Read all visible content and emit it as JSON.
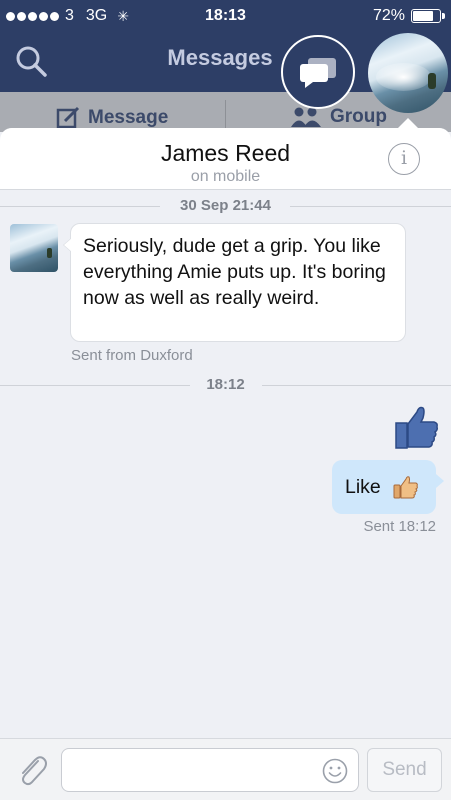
{
  "status_bar": {
    "carrier": "3",
    "network": "3G",
    "time": "18:13",
    "battery": "72%",
    "battery_level": 0.72
  },
  "nav": {
    "title": "Messages"
  },
  "subnav": {
    "message_label": "Message",
    "group_label": "Group"
  },
  "conversation": {
    "contact_name": "James Reed",
    "contact_status": "on mobile",
    "messages": [
      {
        "date_separator": "30 Sep 21:44",
        "direction": "incoming",
        "text": "Seriously, dude get a grip. You like everything Amie puts up. It's boring now as well as really weird.",
        "meta": "Sent from Duxford"
      },
      {
        "date_separator": "18:12",
        "direction": "outgoing",
        "sticker": "like-icon",
        "text": "Like",
        "meta": "Sent 18:12"
      }
    ]
  },
  "composer": {
    "placeholder": "",
    "send_label": "Send"
  },
  "colors": {
    "nav_bg": "#2d3e66",
    "outgoing_bubble": "#cfe7fb",
    "like_blue": "#4d6fb0"
  }
}
